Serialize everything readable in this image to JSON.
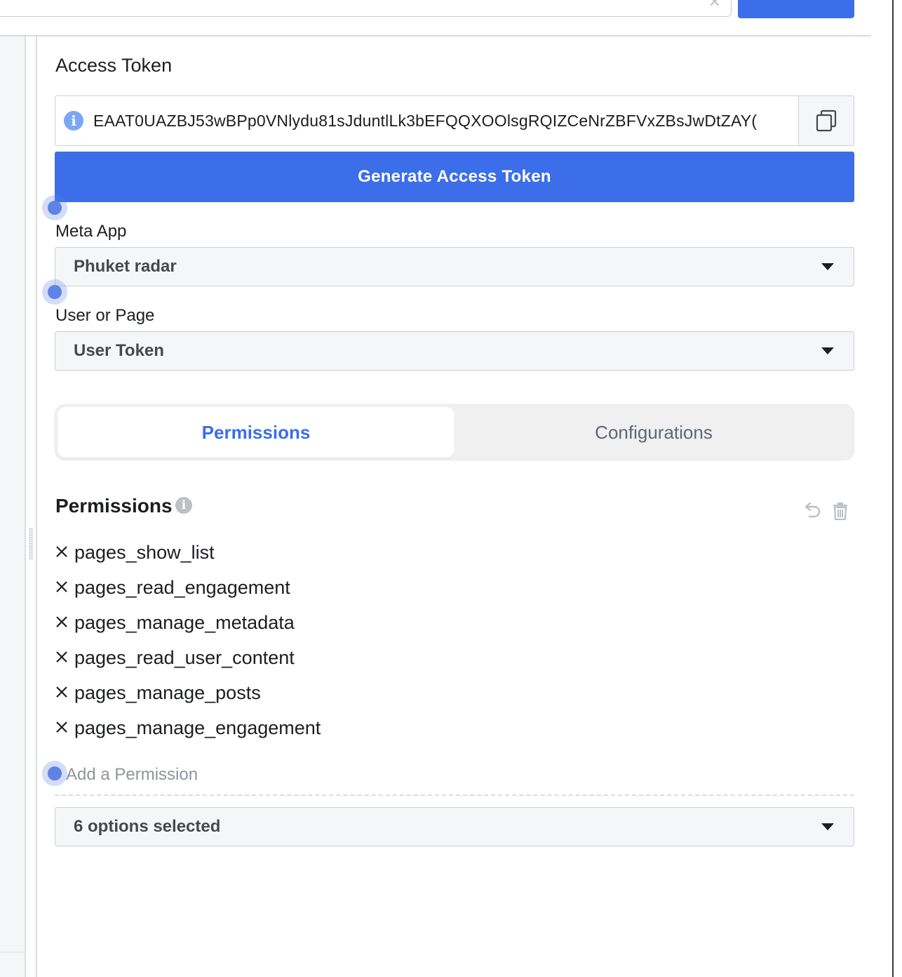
{
  "access_token": {
    "title": "Access Token",
    "value": "EAAT0UAZBJ53wBPp0VNlydu81sJduntlLk3bEFQQXOOlsgRQIZCeNrZBFVxZBsJwDtZAY(",
    "info_icon": "info-icon",
    "copy_icon": "copy-icon"
  },
  "generate_button": {
    "label": "Generate Access Token"
  },
  "meta_app": {
    "label": "Meta App",
    "selected": "Phuket radar"
  },
  "user_or_page": {
    "label": "User or Page",
    "selected": "User Token"
  },
  "tabs": [
    {
      "label": "Permissions",
      "active": true
    },
    {
      "label": "Configurations",
      "active": false
    }
  ],
  "permissions": {
    "title": "Permissions",
    "items": [
      "pages_show_list",
      "pages_read_engagement",
      "pages_manage_metadata",
      "pages_read_user_content",
      "pages_manage_posts",
      "pages_manage_engagement"
    ],
    "add_placeholder": "Add a Permission",
    "summary_select": "6 options selected",
    "icons": [
      "undo-icon",
      "trash-icon",
      "remove-icon"
    ]
  },
  "colors": {
    "accent": "#3b6ee8",
    "step_dot": "#5f82e6",
    "muted_text": "#606770"
  }
}
